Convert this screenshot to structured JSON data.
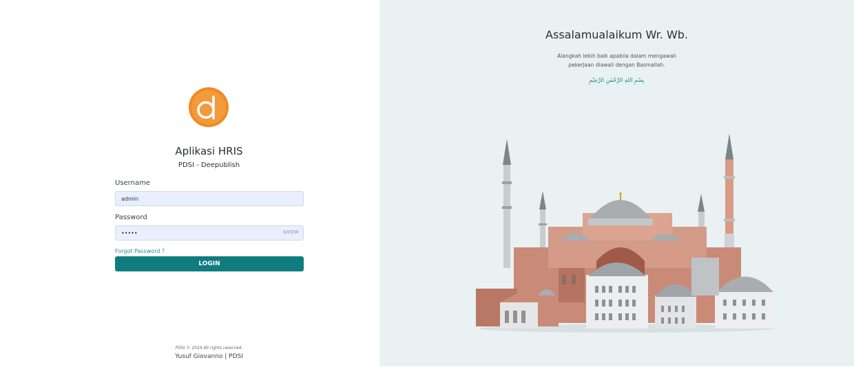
{
  "login": {
    "app_title": "Aplikasi HRIS",
    "app_subtitle": "PDSI - Deepublish",
    "username_label": "Username",
    "username_value": "admin",
    "password_label": "Password",
    "password_value": "•••••",
    "show_label": "SHOW",
    "forgot_label": "Forgot Password ?",
    "login_label": "LOGIN",
    "copyright": "PDSI © 2024 All rights reserved.",
    "author": "Yusuf Giovanno | PDSI",
    "logo_letter": "d"
  },
  "welcome": {
    "greeting": "Assalamualaikum Wr. Wb.",
    "line1": "Alangkah lebih baik apabila dalam mengawali",
    "line2": "pekerjaan diawali dengan Basmallah.",
    "basmallah": "بِسْمِ اللهِ الرَّحْمٰنِ الرَّحِيْمِ"
  },
  "colors": {
    "brand_orange": "#f08a24",
    "accent_teal": "#0f7d80",
    "panel_bg": "#e9f1f2",
    "input_bg": "#e8f0fd"
  },
  "icons": {
    "logo": "deepublish-logo",
    "illustration": "mosque-illustration"
  }
}
